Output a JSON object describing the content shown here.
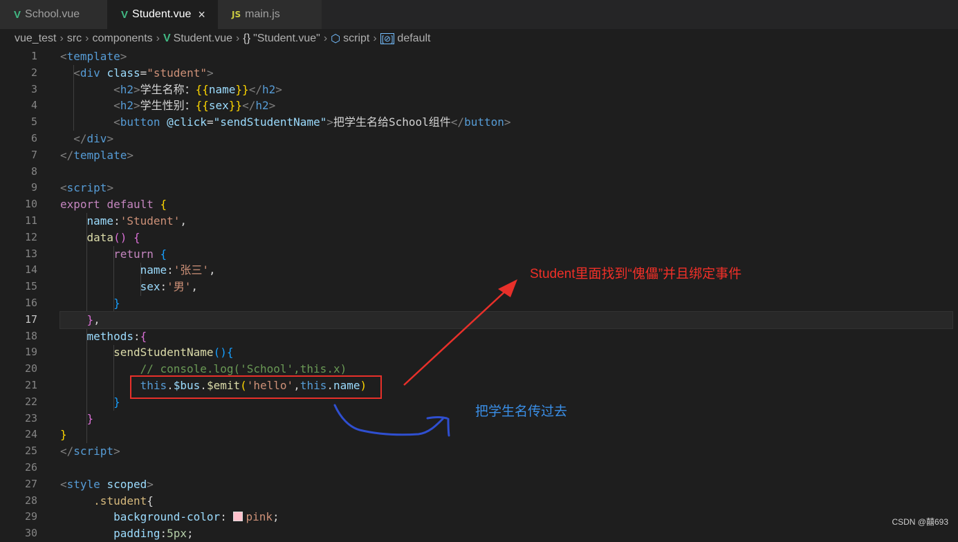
{
  "tabs": [
    {
      "label": "School.vue",
      "icon": "vue-icon",
      "active": false
    },
    {
      "label": "Student.vue",
      "icon": "vue-icon",
      "active": true
    },
    {
      "label": "main.js",
      "icon": "js-icon",
      "active": false
    }
  ],
  "tab_icon_js": "JS",
  "tab_close": "×",
  "breadcrumb": [
    "vue_test",
    "src",
    "components",
    "Student.vue",
    "\"Student.vue\"",
    "script",
    "default"
  ],
  "breadcrumb_icons": {
    "braces": "{}"
  },
  "line_numbers": [
    "1",
    "2",
    "3",
    "4",
    "5",
    "6",
    "7",
    "8",
    "9",
    "10",
    "11",
    "12",
    "13",
    "14",
    "15",
    "16",
    "17",
    "18",
    "19",
    "20",
    "21",
    "22",
    "23",
    "24",
    "25",
    "26",
    "27",
    "28",
    "29",
    "30"
  ],
  "current_line": "17",
  "code_lines": [
    [
      [
        "<",
        "#808080"
      ],
      [
        "template",
        "#569cd6"
      ],
      [
        ">",
        "#808080"
      ]
    ],
    [
      [
        "  ",
        ""
      ],
      [
        "<",
        "#808080"
      ],
      [
        "div",
        "#569cd6"
      ],
      [
        " ",
        ""
      ],
      [
        "class",
        "#9cdcfe"
      ],
      [
        "=",
        "#d4d4d4"
      ],
      [
        "\"student\"",
        "#ce9178"
      ],
      [
        ">",
        "#808080"
      ]
    ],
    [
      [
        "        ",
        ""
      ],
      [
        "<",
        "#808080"
      ],
      [
        "h2",
        "#569cd6"
      ],
      [
        ">",
        "#808080"
      ],
      [
        "学生名称：",
        "#d4d4d4"
      ],
      [
        "{{",
        "#ffd700"
      ],
      [
        "name",
        "#9cdcfe"
      ],
      [
        "}}",
        "#ffd700"
      ],
      [
        "</",
        "#808080"
      ],
      [
        "h2",
        "#569cd6"
      ],
      [
        ">",
        "#808080"
      ]
    ],
    [
      [
        "        ",
        ""
      ],
      [
        "<",
        "#808080"
      ],
      [
        "h2",
        "#569cd6"
      ],
      [
        ">",
        "#808080"
      ],
      [
        "学生性别：",
        "#d4d4d4"
      ],
      [
        "{{",
        "#ffd700"
      ],
      [
        "sex",
        "#9cdcfe"
      ],
      [
        "}}",
        "#ffd700"
      ],
      [
        "</",
        "#808080"
      ],
      [
        "h2",
        "#569cd6"
      ],
      [
        ">",
        "#808080"
      ]
    ],
    [
      [
        "        ",
        ""
      ],
      [
        "<",
        "#808080"
      ],
      [
        "button",
        "#569cd6"
      ],
      [
        " ",
        ""
      ],
      [
        "@click",
        "#9cdcfe"
      ],
      [
        "=",
        "#d4d4d4"
      ],
      [
        "\"sendStudentName\"",
        "#9cdcfe"
      ],
      [
        ">",
        "#808080"
      ],
      [
        "把学生名给School组件",
        "#d4d4d4"
      ],
      [
        "</",
        "#808080"
      ],
      [
        "button",
        "#569cd6"
      ],
      [
        ">",
        "#808080"
      ]
    ],
    [
      [
        "  ",
        ""
      ],
      [
        "</",
        "#808080"
      ],
      [
        "div",
        "#569cd6"
      ],
      [
        ">",
        "#808080"
      ]
    ],
    [
      [
        "</",
        "#808080"
      ],
      [
        "template",
        "#569cd6"
      ],
      [
        ">",
        "#808080"
      ]
    ],
    [],
    [
      [
        "<",
        "#808080"
      ],
      [
        "script",
        "#569cd6"
      ],
      [
        ">",
        "#808080"
      ]
    ],
    [
      [
        "export",
        "#c586c0"
      ],
      [
        " ",
        ""
      ],
      [
        "default",
        "#c586c0"
      ],
      [
        " ",
        ""
      ],
      [
        "{",
        "#ffd700"
      ]
    ],
    [
      [
        "    ",
        ""
      ],
      [
        "name",
        "#9cdcfe"
      ],
      [
        ":",
        "#d4d4d4"
      ],
      [
        "'Student'",
        "#ce9178"
      ],
      [
        ",",
        "#d4d4d4"
      ]
    ],
    [
      [
        "    ",
        ""
      ],
      [
        "data",
        "#dcdcaa"
      ],
      [
        "()",
        "#da70d6"
      ],
      [
        " ",
        ""
      ],
      [
        "{",
        "#da70d6"
      ]
    ],
    [
      [
        "        ",
        ""
      ],
      [
        "return",
        "#c586c0"
      ],
      [
        " ",
        ""
      ],
      [
        "{",
        "#179fff"
      ]
    ],
    [
      [
        "            ",
        ""
      ],
      [
        "name",
        "#9cdcfe"
      ],
      [
        ":",
        "#d4d4d4"
      ],
      [
        "'张三'",
        "#ce9178"
      ],
      [
        ",",
        "#d4d4d4"
      ]
    ],
    [
      [
        "            ",
        ""
      ],
      [
        "sex",
        "#9cdcfe"
      ],
      [
        ":",
        "#d4d4d4"
      ],
      [
        "'男'",
        "#ce9178"
      ],
      [
        ",",
        "#d4d4d4"
      ]
    ],
    [
      [
        "        ",
        ""
      ],
      [
        "}",
        "#179fff"
      ]
    ],
    [
      [
        "    ",
        ""
      ],
      [
        "}",
        "#da70d6"
      ],
      [
        ",",
        "#d4d4d4"
      ]
    ],
    [
      [
        "    ",
        ""
      ],
      [
        "methods",
        "#9cdcfe"
      ],
      [
        ":",
        "#d4d4d4"
      ],
      [
        "{",
        "#da70d6"
      ]
    ],
    [
      [
        "        ",
        ""
      ],
      [
        "sendStudentName",
        "#dcdcaa"
      ],
      [
        "()",
        "#179fff"
      ],
      [
        "{",
        "#179fff"
      ]
    ],
    [
      [
        "            ",
        ""
      ],
      [
        "// console.log('School',this.x)",
        "#6a9955"
      ]
    ],
    [
      [
        "            ",
        ""
      ],
      [
        "this",
        "#569cd6"
      ],
      [
        ".",
        "#d4d4d4"
      ],
      [
        "$bus",
        "#9cdcfe"
      ],
      [
        ".",
        "#d4d4d4"
      ],
      [
        "$emit",
        "#dcdcaa"
      ],
      [
        "(",
        "#ffd700"
      ],
      [
        "'hello'",
        "#ce9178"
      ],
      [
        ",",
        "#d4d4d4"
      ],
      [
        "this",
        "#569cd6"
      ],
      [
        ".",
        "#d4d4d4"
      ],
      [
        "name",
        "#9cdcfe"
      ],
      [
        ")",
        "#ffd700"
      ]
    ],
    [
      [
        "        ",
        ""
      ],
      [
        "}",
        "#179fff"
      ]
    ],
    [
      [
        "    ",
        ""
      ],
      [
        "}",
        "#da70d6"
      ]
    ],
    [
      [
        "}",
        "#ffd700"
      ]
    ],
    [
      [
        "</",
        "#808080"
      ],
      [
        "script",
        "#569cd6"
      ],
      [
        ">",
        "#808080"
      ]
    ],
    [],
    [
      [
        "<",
        "#808080"
      ],
      [
        "style",
        "#569cd6"
      ],
      [
        " ",
        ""
      ],
      [
        "scoped",
        "#9cdcfe"
      ],
      [
        ">",
        "#808080"
      ]
    ],
    [
      [
        "     ",
        ""
      ],
      [
        ".student",
        "#d7ba7d"
      ],
      [
        "{",
        "#d4d4d4"
      ]
    ],
    [
      [
        "        ",
        ""
      ],
      [
        "background-color",
        "#9cdcfe"
      ],
      [
        ": ",
        "#d4d4d4"
      ],
      [
        "__SWATCH__",
        ""
      ],
      [
        "pink",
        "#ce9178"
      ],
      [
        ";",
        "#d4d4d4"
      ]
    ],
    [
      [
        "        ",
        ""
      ],
      [
        "padding",
        "#9cdcfe"
      ],
      [
        ":",
        "#d4d4d4"
      ],
      [
        "5px",
        "#b5cea8"
      ],
      [
        ";",
        "#d4d4d4"
      ]
    ]
  ],
  "annotations": {
    "red_text": "Student里面找到“傀儡”并且绑定事件",
    "blue_text": "把学生名传过去"
  },
  "colors": {
    "red_annotation": "#f03028",
    "blue_annotation": "#3a8fe8",
    "blue_stroke": "#2f4fd0"
  },
  "watermark": "CSDN @囍693"
}
